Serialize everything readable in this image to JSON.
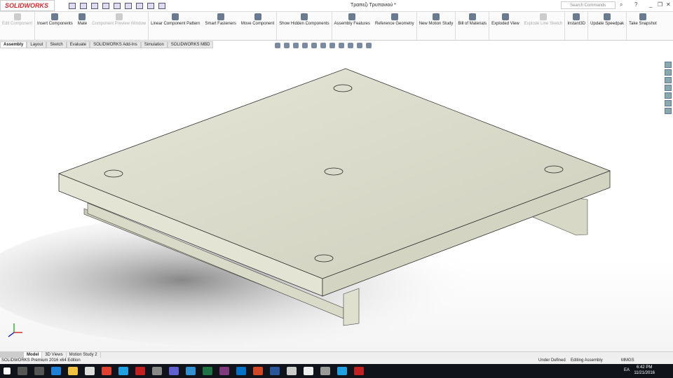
{
  "app": {
    "logo": "SOLIDWORKS",
    "doc_title": "Τραπεζι Τρυπανιού *",
    "search_placeholder": "Search Commands"
  },
  "ribbon": [
    {
      "label": "Edit Component",
      "enabled": false
    },
    {
      "label": "Insert Components",
      "enabled": true
    },
    {
      "label": "Mate",
      "enabled": true
    },
    {
      "label": "Component Preview Window",
      "enabled": false
    },
    {
      "label": "Linear Component Pattern",
      "enabled": true
    },
    {
      "label": "Smart Fasteners",
      "enabled": true
    },
    {
      "label": "Move Component",
      "enabled": true
    },
    {
      "label": "Show Hidden Components",
      "enabled": true
    },
    {
      "label": "Assembly Features",
      "enabled": true
    },
    {
      "label": "Reference Geometry",
      "enabled": true
    },
    {
      "label": "New Motion Study",
      "enabled": true
    },
    {
      "label": "Bill of Materials",
      "enabled": true
    },
    {
      "label": "Exploded View",
      "enabled": true
    },
    {
      "label": "Explode Line Sketch",
      "enabled": false
    },
    {
      "label": "Instant3D",
      "enabled": true
    },
    {
      "label": "Update Speedpak",
      "enabled": true
    },
    {
      "label": "Take Snapshot",
      "enabled": true
    }
  ],
  "tabs": [
    "Assembly",
    "Layout",
    "Sketch",
    "Evaluate",
    "SOLIDWORKS Add-Ins",
    "Simulation",
    "SOLIDWORKS MBD"
  ],
  "bottom_tabs": [
    "Model",
    "3D Views",
    "Motion Study 2"
  ],
  "status": {
    "edition": "SOLIDWORKS Premium 2016 x64 Edition",
    "state": "Under Defined",
    "mode": "Editing Assembly",
    "units": "MMGS"
  },
  "taskbar": {
    "lang": "EA",
    "time": "6:42 PM",
    "date": "11/21/2016"
  },
  "colors": {
    "taskbar": "#10141a",
    "brand": "#d1282e",
    "part": "#dcdccb"
  }
}
